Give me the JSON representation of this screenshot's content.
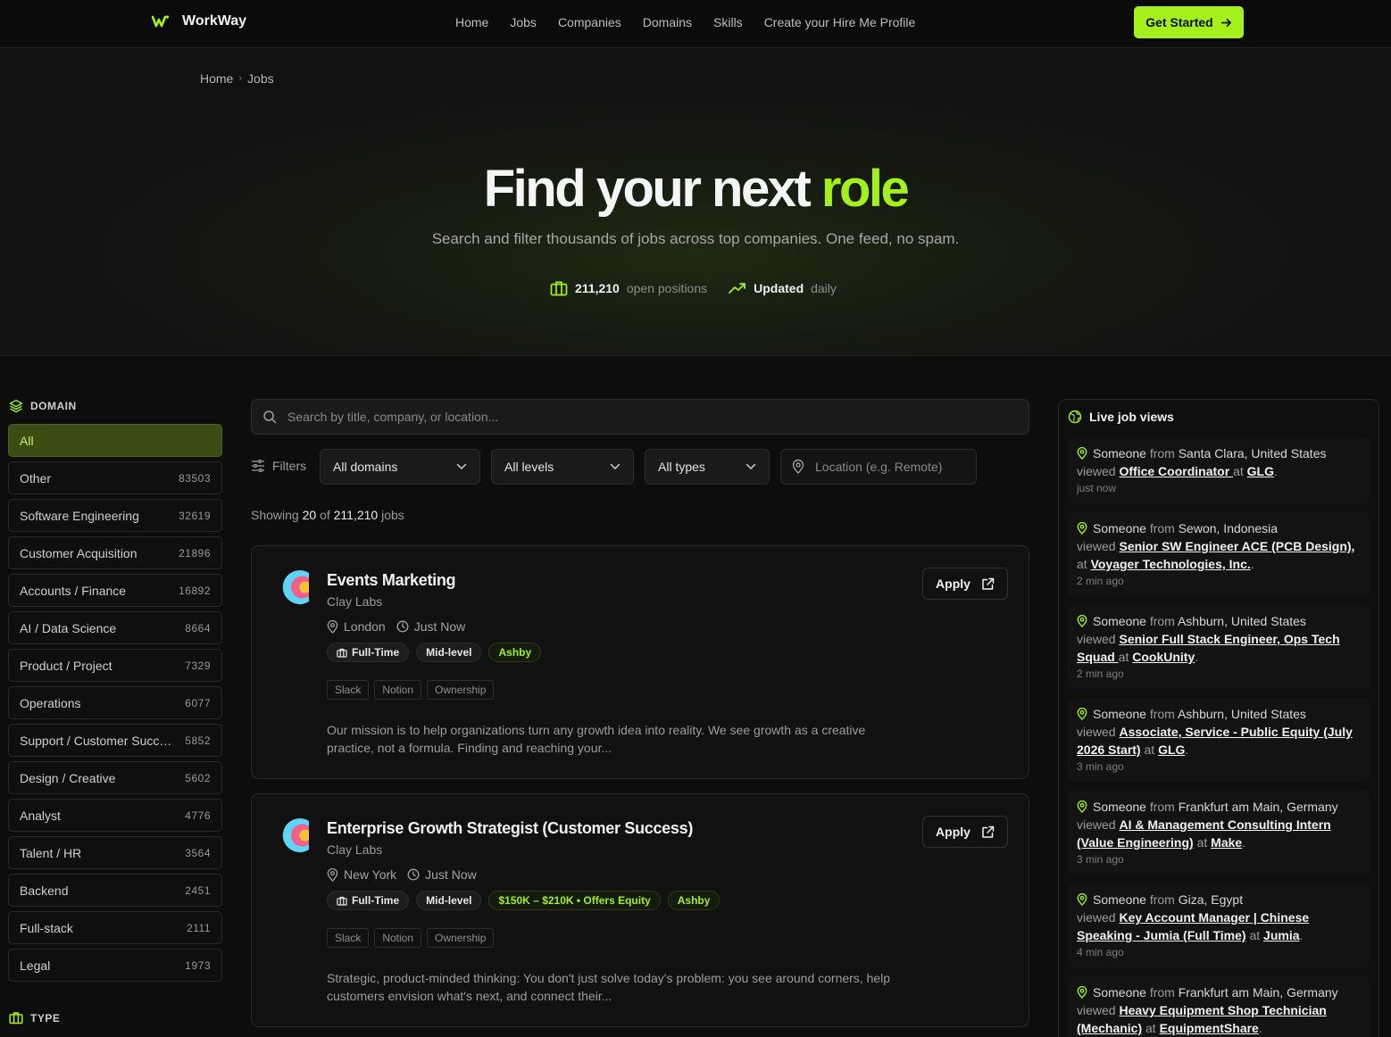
{
  "brand": {
    "name": "WorkWay"
  },
  "nav": {
    "links": [
      "Home",
      "Jobs",
      "Companies",
      "Domains",
      "Skills",
      "Create your Hire Me Profile"
    ],
    "cta": "Get Started"
  },
  "breadcrumb": {
    "items": [
      "Home",
      "Jobs"
    ]
  },
  "hero": {
    "title_main": "Find your next ",
    "title_accent": "role",
    "subtitle": "Search and filter thousands of jobs across top companies. One feed, no spam.",
    "stat_positions_value": "211,210",
    "stat_positions_label": "open positions",
    "stat_updated_value": "Updated",
    "stat_updated_label": "daily"
  },
  "sidebar": {
    "domain_heading": "DOMAIN",
    "type_heading": "TYPE",
    "domains": [
      {
        "name": "All",
        "count": ""
      },
      {
        "name": "Other",
        "count": "83503"
      },
      {
        "name": "Software Engineering",
        "count": "32619"
      },
      {
        "name": "Customer Acquisition",
        "count": "21896"
      },
      {
        "name": "Accounts / Finance",
        "count": "16892"
      },
      {
        "name": "AI / Data Science",
        "count": "8664"
      },
      {
        "name": "Product / Project",
        "count": "7329"
      },
      {
        "name": "Operations",
        "count": "6077"
      },
      {
        "name": "Support / Customer Success",
        "count": "5852"
      },
      {
        "name": "Design / Creative",
        "count": "5602"
      },
      {
        "name": "Analyst",
        "count": "4776"
      },
      {
        "name": "Talent / HR",
        "count": "3564"
      },
      {
        "name": "Backend",
        "count": "2451"
      },
      {
        "name": "Full-stack",
        "count": "2111"
      },
      {
        "name": "Legal",
        "count": "1973"
      }
    ]
  },
  "search": {
    "placeholder": "Search by title, company, or location..."
  },
  "filters": {
    "label": "Filters",
    "domain": "All domains",
    "level": "All levels",
    "type": "All types",
    "location_placeholder": "Location (e.g. Remote)"
  },
  "results": {
    "prefix": "Showing",
    "shown": "20",
    "of": "of",
    "total": "211,210",
    "suffix": "jobs"
  },
  "jobs": [
    {
      "title": "Events Marketing",
      "company": "Clay Labs",
      "location": "London",
      "posted": "Just Now",
      "type": "Full-Time",
      "level": "Mid-level",
      "salary": "",
      "source": "Ashby",
      "skills": [
        "Slack",
        "Notion",
        "Ownership"
      ],
      "description": "Our mission is to help organizations turn any growth idea into reality. We see growth as a creative practice, not a formula. Finding and reaching your...",
      "apply": "Apply"
    },
    {
      "title": "Enterprise Growth Strategist (Customer Success)",
      "company": "Clay Labs",
      "location": "New York",
      "posted": "Just Now",
      "type": "Full-Time",
      "level": "Mid-level",
      "salary": "$150K – $210K • Offers Equity",
      "source": "Ashby",
      "skills": [
        "Slack",
        "Notion",
        "Ownership"
      ],
      "description": "Strategic, product-minded thinking: You don't just solve today's problem: you see around corners, help customers envision what's next, and connect their...",
      "apply": "Apply"
    }
  ],
  "live": {
    "heading": "Live job views",
    "someone": "Someone",
    "from": "from",
    "viewed": "viewed",
    "at": "at",
    "items": [
      {
        "location": "Santa Clara, United States",
        "role": "Office Coordinator ",
        "company": "GLG",
        "ago": "just now"
      },
      {
        "location": "Sewon, Indonesia",
        "role": "Senior SW Engineer ACE (PCB Design), ",
        "company": "Voyager Technologies, Inc.",
        "ago": "2 min ago"
      },
      {
        "location": "Ashburn, United States",
        "role": "Senior Full Stack Engineer, Ops Tech Squad ",
        "company": "CookUnity",
        "ago": "2 min ago"
      },
      {
        "location": "Ashburn, United States",
        "role": "Associate, Service - Public Equity (July 2026 Start)",
        "company": "GLG",
        "ago": "3 min ago"
      },
      {
        "location": "Frankfurt am Main, Germany",
        "role": "AI & Management Consulting Intern (Value Engineering)",
        "company": "Make",
        "ago": "3 min ago"
      },
      {
        "location": "Giza, Egypt",
        "role": "Key Account Manager | Chinese Speaking - Jumia (Full Time)",
        "company": "Jumia",
        "ago": "4 min ago"
      },
      {
        "location": "Frankfurt am Main, Germany",
        "role": "Heavy Equipment Shop Technician (Mechanic)",
        "company": "EquipmentShare",
        "ago": ""
      }
    ]
  },
  "colors": {
    "accent": "#a3f01c",
    "background": "#0d0d0d",
    "active_domain": "#3a4d14"
  }
}
